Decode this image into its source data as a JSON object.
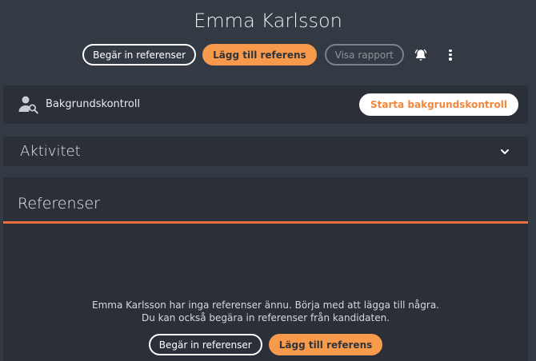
{
  "header": {
    "title": "Emma Karlsson",
    "request_label": "Begär in referenser",
    "add_label": "Lägg till referens",
    "report_label": "Visa rapport"
  },
  "background_check": {
    "label": "Bakgrundskontroll",
    "button_label": "Starta bakgrundskontroll"
  },
  "activity": {
    "label": "Aktivitet"
  },
  "references": {
    "title": "Referenser",
    "empty_line1": "Emma Karlsson har inga referenser ännu. Börja med att lägga till några.",
    "empty_line2": "Du kan också begära in referenser från kandidaten.",
    "request_label": "Begär in referenser",
    "add_label": "Lägg till referens"
  },
  "colors": {
    "background": "#343a43",
    "card": "#2b3038",
    "accent": "#f79a4c",
    "accent_line": "#e8703f"
  },
  "icons": [
    "bell-icon",
    "more-vertical-icon",
    "user-search-icon",
    "chevron-down-icon"
  ]
}
